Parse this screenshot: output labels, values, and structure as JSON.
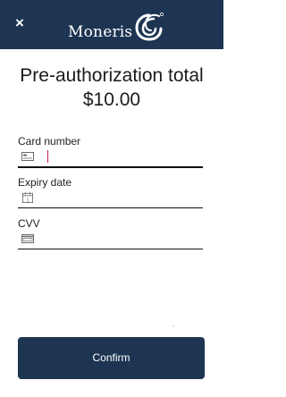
{
  "header": {
    "close_glyph": "×",
    "brand_name": "Moneris",
    "logo_icon": "moneris-swirl-logo",
    "background": "#1d3552"
  },
  "main": {
    "title": "Pre-authorization total",
    "amount": "$10.00"
  },
  "form": {
    "card_number": {
      "label": "Card number",
      "value": "",
      "icon": "credit-card-icon"
    },
    "expiry_date": {
      "label": "Expiry date",
      "value": "",
      "icon": "calendar-icon"
    },
    "cvv": {
      "label": "CVV",
      "value": "",
      "icon": "cvv-card-icon"
    }
  },
  "actions": {
    "confirm_label": "Confirm",
    "confirm_color": "#1d3552"
  },
  "colors": {
    "caret": "#d01a5e"
  }
}
